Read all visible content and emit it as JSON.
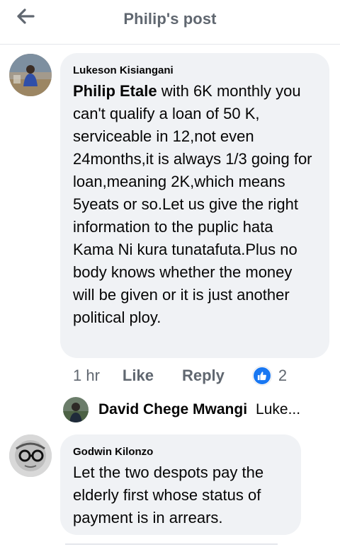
{
  "header": {
    "title": "Philip's post",
    "back_icon": "arrow-left-icon"
  },
  "comments": [
    {
      "author": "Lukeson Kisiangani",
      "tagged": "Philip Etale",
      "text": " with 6K monthly you can't qualify a loan of 50 K, serviceable in 12,not even 24months,it is always 1/3 going for loan,meaning 2K,which means 5yeats or so.Let us give the right information to the puplic hata Kama Ni kura tunatafuta.Plus no body knows whether the money will be given or it is just another political ploy.",
      "time": "1 hr",
      "like_label": "Like",
      "reply_label": "Reply",
      "reaction_count": "2",
      "reaction_icon": "thumbs-up-icon",
      "reply_preview": {
        "name": "David Chege Mwangi",
        "snippet": "Luke..."
      }
    },
    {
      "author": "Godwin Kilonzo",
      "text": "Let the  two despots pay the elderly first whose status of payment is in arrears."
    }
  ],
  "colors": {
    "accent": "#1877f2",
    "bubble": "#f0f2f5",
    "muted_text": "#606770"
  }
}
